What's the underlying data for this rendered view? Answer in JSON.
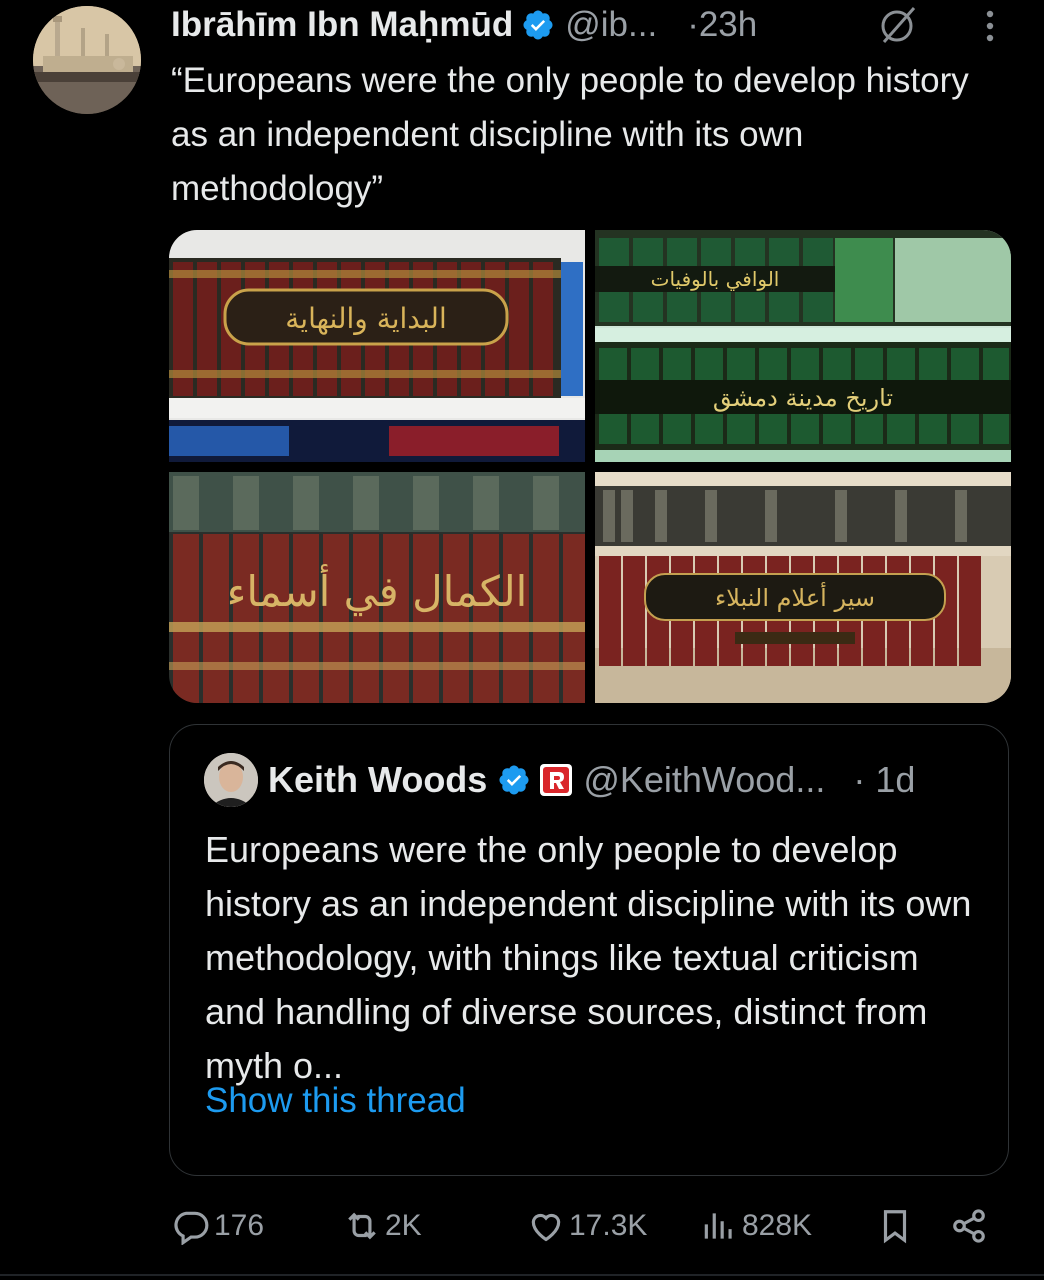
{
  "tweet": {
    "author_name": "Ibrāhīm Ibn Maḥmūd",
    "handle": "@ib...",
    "time": "·23h",
    "text": "“Europeans were the only people to develop history as an independent discipline with its own methodology”",
    "images": [
      {
        "spine_title": "البداية والنهاية"
      },
      {
        "spine_title_top": "الوافي بالوفيات",
        "spine_title_bottom": "تاريخ مدينة دمشق"
      },
      {
        "spine_title": "الكمال في أسماء"
      },
      {
        "spine_title": "سير أعلام النبلاء"
      }
    ]
  },
  "quoted": {
    "author_name": "Keith Woods",
    "handle": "@KeithWood...",
    "time": "· 1d",
    "text": "Europeans were the only people to develop history as an independent discipline with its own methodology, with things like textual criticism and handling of diverse sources, distinct from myth o...",
    "show_thread": "Show this thread"
  },
  "actions": {
    "replies": "176",
    "reposts": "2K",
    "likes": "17.3K",
    "views": "828K"
  },
  "colors": {
    "background": "#000000",
    "text": "#e7e9ea",
    "secondary": "#9aa0a6",
    "accent": "#1d9bf0",
    "border": "#2f3336"
  },
  "icons": [
    "verified-badge-icon",
    "grok-icon",
    "more-icon",
    "reply-icon",
    "repost-icon",
    "like-icon",
    "views-icon",
    "bookmark-icon",
    "share-icon",
    "rumble-badge-icon"
  ]
}
